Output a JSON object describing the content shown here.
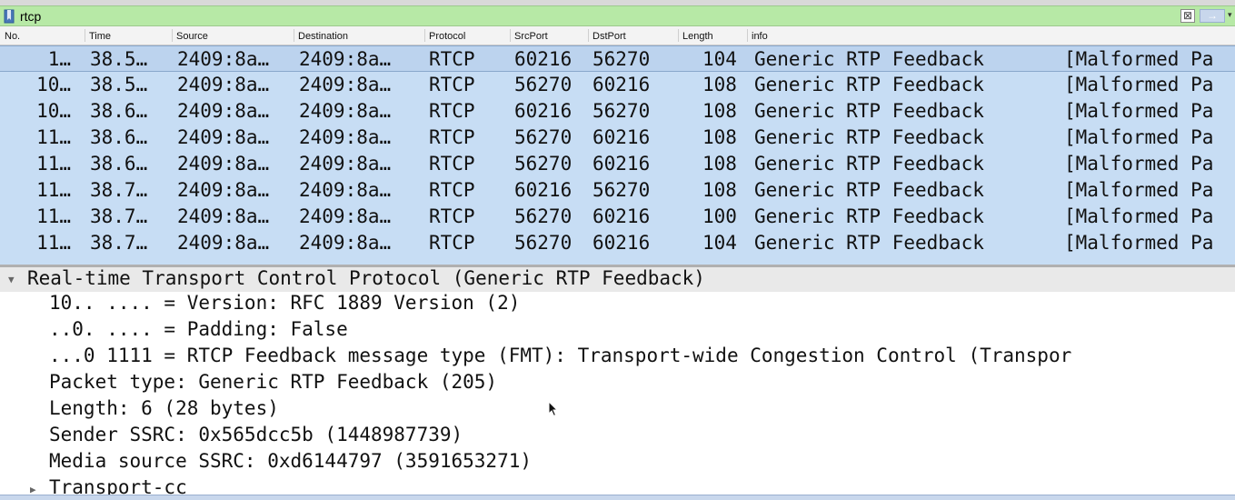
{
  "filter": {
    "value": "rtcp",
    "clear_glyph": "⊠",
    "apply_glyph": "→",
    "dropdown_glyph": "▾",
    "bar_color": "#b7e9a6"
  },
  "columns": [
    "No.",
    "Time",
    "Source",
    "Destination",
    "Protocol",
    "SrcPort",
    "DstPort",
    "Length",
    "info"
  ],
  "packets": [
    {
      "no": "1…",
      "time": "38.5…",
      "source": "2409:8a…",
      "destination": "2409:8a…",
      "protocol": "RTCP",
      "srcport": "60216",
      "dstport": "56270",
      "length": "104",
      "info": "Generic RTP Feedback",
      "info2": "[Malformed Pa"
    },
    {
      "no": "10…",
      "time": "38.5…",
      "source": "2409:8a…",
      "destination": "2409:8a…",
      "protocol": "RTCP",
      "srcport": "56270",
      "dstport": "60216",
      "length": "108",
      "info": "Generic RTP Feedback",
      "info2": "[Malformed Pa"
    },
    {
      "no": "10…",
      "time": "38.6…",
      "source": "2409:8a…",
      "destination": "2409:8a…",
      "protocol": "RTCP",
      "srcport": "60216",
      "dstport": "56270",
      "length": "108",
      "info": "Generic RTP Feedback",
      "info2": "[Malformed Pa"
    },
    {
      "no": "11…",
      "time": "38.6…",
      "source": "2409:8a…",
      "destination": "2409:8a…",
      "protocol": "RTCP",
      "srcport": "56270",
      "dstport": "60216",
      "length": "108",
      "info": "Generic RTP Feedback",
      "info2": "[Malformed Pa"
    },
    {
      "no": "11…",
      "time": "38.6…",
      "source": "2409:8a…",
      "destination": "2409:8a…",
      "protocol": "RTCP",
      "srcport": "56270",
      "dstport": "60216",
      "length": "108",
      "info": "Generic RTP Feedback",
      "info2": "[Malformed Pa"
    },
    {
      "no": "11…",
      "time": "38.7…",
      "source": "2409:8a…",
      "destination": "2409:8a…",
      "protocol": "RTCP",
      "srcport": "60216",
      "dstport": "56270",
      "length": "108",
      "info": "Generic RTP Feedback",
      "info2": "[Malformed Pa"
    },
    {
      "no": "11…",
      "time": "38.7…",
      "source": "2409:8a…",
      "destination": "2409:8a…",
      "protocol": "RTCP",
      "srcport": "56270",
      "dstport": "60216",
      "length": "100",
      "info": "Generic RTP Feedback",
      "info2": "[Malformed Pa"
    },
    {
      "no": "11…",
      "time": "38.7…",
      "source": "2409:8a…",
      "destination": "2409:8a…",
      "protocol": "RTCP",
      "srcport": "56270",
      "dstport": "60216",
      "length": "104",
      "info": "Generic RTP Feedback",
      "info2": "[Malformed Pa"
    }
  ],
  "details": {
    "header": "Real-time Transport Control Protocol (Generic RTP Feedback)",
    "header_toggle": "▼",
    "lines": [
      "10.. .... = Version: RFC 1889 Version (2)",
      "..0. .... = Padding: False",
      "...0 1111 = RTCP Feedback message type (FMT): Transport-wide Congestion Control (Transpor",
      "Packet type: Generic RTP Feedback (205)",
      "Length: 6 (28 bytes)",
      "Sender SSRC: 0x565dcc5b (1448987739)",
      "Media source SSRC: 0xd6144797 (3591653271)"
    ],
    "subtree_label": "Transport-cc",
    "subtree_toggle": "▶"
  },
  "colors": {
    "row_bg": "#c7ddf4",
    "selected_row_bg": "#bcd3ee",
    "details_header_bg": "#e9e9e9"
  }
}
